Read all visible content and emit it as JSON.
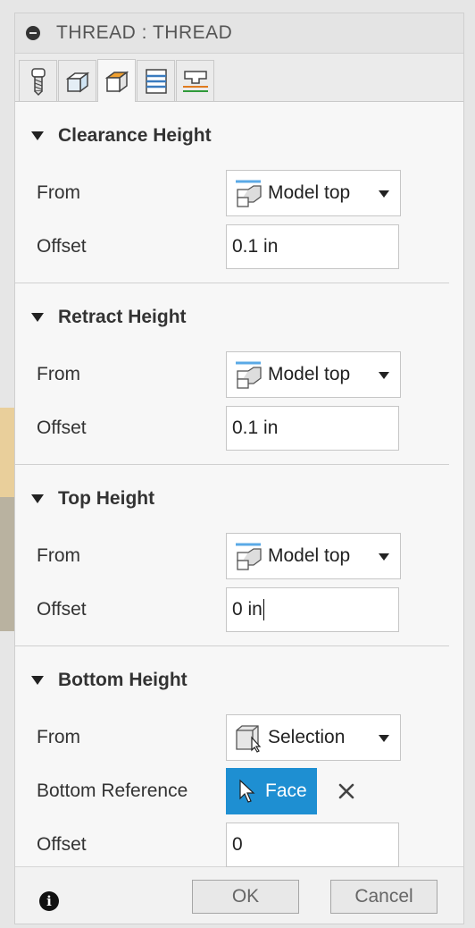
{
  "dialog": {
    "title": "THREAD : THREAD"
  },
  "tabs": [
    {
      "name": "tool",
      "icon": "drill-tool-icon",
      "active": false
    },
    {
      "name": "geometry",
      "icon": "geometry-box-icon",
      "active": false
    },
    {
      "name": "heights",
      "icon": "heights-box-icon",
      "active": true
    },
    {
      "name": "passes",
      "icon": "passes-icon",
      "active": false
    },
    {
      "name": "linking",
      "icon": "linking-icon",
      "active": false
    }
  ],
  "sections": {
    "clearance": {
      "title": "Clearance Height",
      "from_label": "From",
      "from_value": "Model top",
      "offset_label": "Offset",
      "offset_value": "0.1 in"
    },
    "retract": {
      "title": "Retract Height",
      "from_label": "From",
      "from_value": "Model top",
      "offset_label": "Offset",
      "offset_value": "0.1 in"
    },
    "top": {
      "title": "Top Height",
      "from_label": "From",
      "from_value": "Model top",
      "offset_label": "Offset",
      "offset_value": "0 in"
    },
    "bottom": {
      "title": "Bottom Height",
      "from_label": "From",
      "from_value": "Selection",
      "reference_label": "Bottom Reference",
      "reference_value": "Face",
      "offset_label": "Offset",
      "offset_value": "0"
    }
  },
  "footer": {
    "ok_label": "OK",
    "cancel_label": "Cancel",
    "info_icon": "info-icon"
  },
  "colors": {
    "accent": "#1e8fd2",
    "model_top_line": "#5aa9e6",
    "tab_highlight": "#f0a030"
  }
}
